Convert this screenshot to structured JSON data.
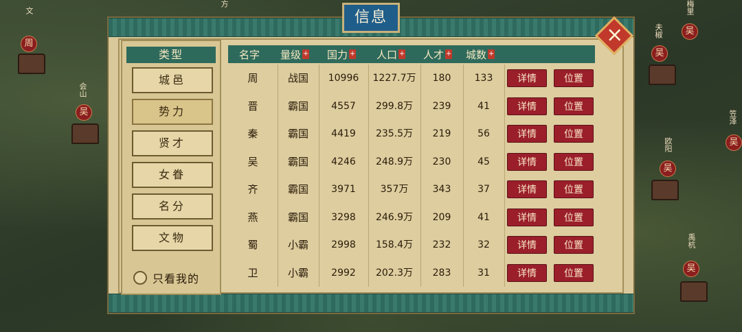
{
  "dialog": {
    "title": "信息",
    "close_label": "×"
  },
  "sidebar": {
    "header": "类型",
    "items": [
      "城邑",
      "势力",
      "贤才",
      "女眷",
      "名分",
      "文物"
    ],
    "active_index": 1,
    "only_mine_label": "只看我的"
  },
  "table": {
    "columns": [
      "名字",
      "量级",
      "国力",
      "人口",
      "人才",
      "城数"
    ],
    "sort_mark": "+",
    "detail_label": "详情",
    "location_label": "位置",
    "rows": [
      {
        "name": "周",
        "grade": "战国",
        "power": "10996",
        "pop": "1227.7万",
        "talent": "180",
        "cities": "133"
      },
      {
        "name": "晋",
        "grade": "霸国",
        "power": "4557",
        "pop": "299.8万",
        "talent": "239",
        "cities": "41"
      },
      {
        "name": "秦",
        "grade": "霸国",
        "power": "4419",
        "pop": "235.5万",
        "talent": "219",
        "cities": "56"
      },
      {
        "name": "吴",
        "grade": "霸国",
        "power": "4246",
        "pop": "248.9万",
        "talent": "230",
        "cities": "45"
      },
      {
        "name": "齐",
        "grade": "霸国",
        "power": "3971",
        "pop": "357万",
        "talent": "343",
        "cities": "37"
      },
      {
        "name": "燕",
        "grade": "霸国",
        "power": "3298",
        "pop": "246.9万",
        "talent": "209",
        "cities": "41"
      },
      {
        "name": "蜀",
        "grade": "小霸",
        "power": "2998",
        "pop": "158.4万",
        "talent": "232",
        "cities": "32"
      },
      {
        "name": "卫",
        "grade": "小霸",
        "power": "2992",
        "pop": "202.3万",
        "talent": "283",
        "cities": "31"
      }
    ]
  },
  "map": {
    "labels": [
      {
        "text": "周",
        "badge": true
      },
      {
        "text": "吴",
        "badge": true
      },
      {
        "text": "吴",
        "badge": true
      },
      {
        "text": "吴",
        "badge": true
      },
      {
        "text": "吴",
        "badge": true
      },
      {
        "text": "吴",
        "badge": true
      },
      {
        "text": "吴",
        "badge": true
      }
    ],
    "place_names": [
      "文",
      "会山",
      "方",
      "梅里",
      "夫椒",
      "笠泽",
      "欧阳",
      "禹杭"
    ]
  },
  "colors": {
    "accent_teal": "#2e6a5c",
    "button_red": "#9a1f2b",
    "title_blue": "#1f5d8a",
    "parchment": "#ddcd9f"
  }
}
